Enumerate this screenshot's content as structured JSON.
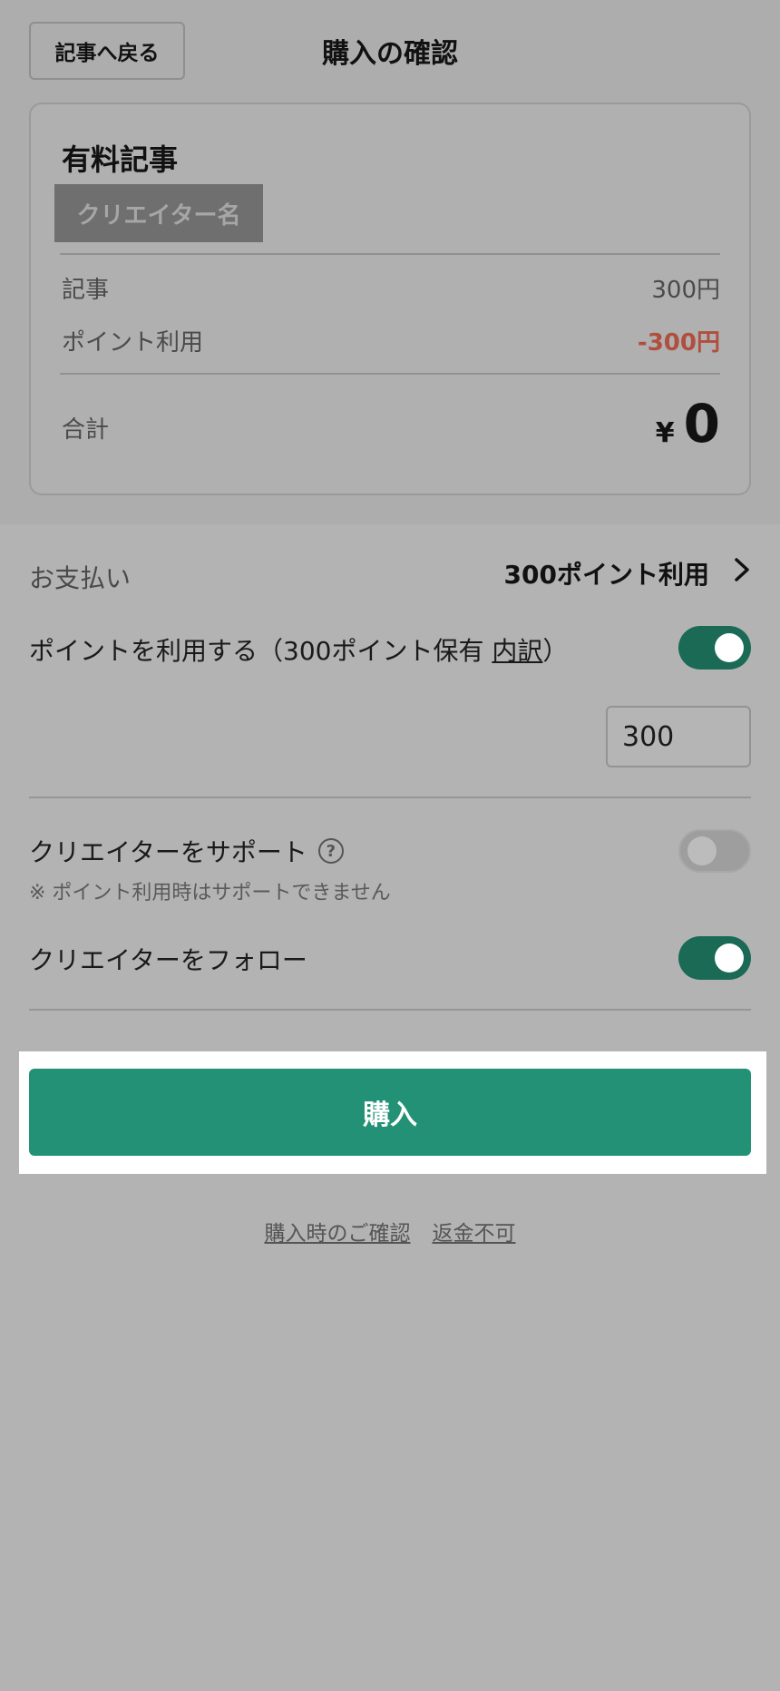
{
  "header": {
    "back_label": "記事へ戻る",
    "title": "購入の確認"
  },
  "summary": {
    "article_title": "有料記事",
    "creator_name": "クリエイター名",
    "rows": [
      {
        "label": "記事",
        "value": "300円"
      },
      {
        "label": "ポイント利用",
        "value": "-300円"
      }
    ],
    "total_label": "合計",
    "currency_symbol": "¥",
    "total_value": "0"
  },
  "payment": {
    "label": "お支払い",
    "value": "300ポイント利用",
    "points_label_prefix": "ポイントを利用する（300ポイント保有 ",
    "points_breakdown_link": "内訳",
    "points_label_suffix": "）",
    "use_points_enabled": true,
    "points_value": "300"
  },
  "options": {
    "support_label": "クリエイターをサポート",
    "support_note": "※ ポイント利用時はサポートできません",
    "support_enabled": false,
    "follow_label": "クリエイターをフォロー",
    "follow_enabled": true
  },
  "purchase": {
    "button_label": "購入",
    "link_confirm": "購入時のご確認",
    "link_refund": "返金不可"
  },
  "colors": {
    "accent": "#229175",
    "toggle_on": "#1a6a55",
    "negative": "#b14f3e"
  }
}
